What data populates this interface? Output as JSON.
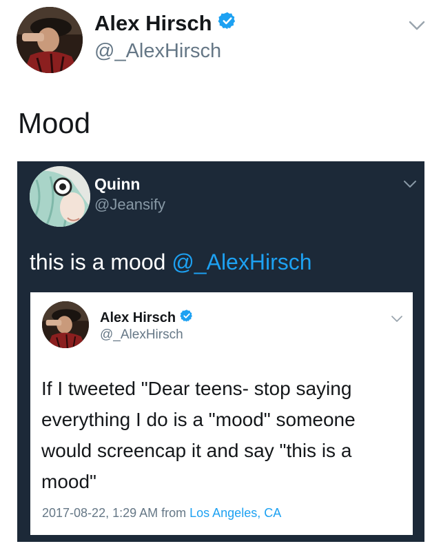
{
  "outer_tweet": {
    "author_name": "Alex Hirsch",
    "handle": "@_AlexHirsch",
    "text": "Mood",
    "icons": {
      "verified": "verified-badge-icon",
      "menu": "chevron-down-icon"
    }
  },
  "quoted_tweet": {
    "author_name": "Quinn",
    "handle": "@Jeansify",
    "text": "this is a mood ",
    "mention": "@_AlexHirsch",
    "icons": {
      "menu": "chevron-down-icon"
    }
  },
  "screenshot_tweet": {
    "author_name": "Alex Hirsch",
    "handle": "@_AlexHirsch",
    "text": "If I tweeted \"Dear teens- stop saying everything I do is a \"mood\" someone would screencap it and say \"this is a mood\"",
    "timestamp": "2017-08-22, 1:29 AM from ",
    "location": "Los Angeles, CA",
    "icons": {
      "verified": "verified-badge-icon",
      "menu": "chevron-down-icon"
    }
  },
  "colors": {
    "verified_blue": "#1da1f2",
    "link_blue": "#1da1f2",
    "dark_card_bg": "#1c2938",
    "secondary_text": "#657786"
  }
}
